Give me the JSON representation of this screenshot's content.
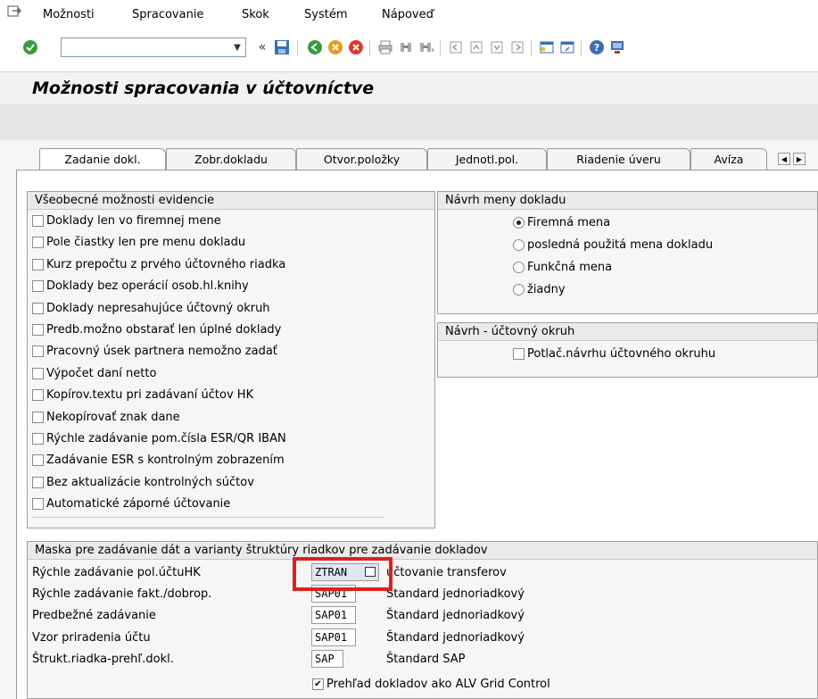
{
  "menu": {
    "items": [
      "Možnosti",
      "Spracovanie",
      "Skok",
      "Systém",
      "Nápoveď"
    ]
  },
  "toolbar": {
    "command_value": ""
  },
  "title": "Možnosti spracovania v účtovníctve",
  "tabs": [
    "Zadanie dokl.",
    "Zobr.dokladu",
    "Otvor.položky",
    "Jednotl.pol.",
    "Riadenie úveru",
    "Avíza"
  ],
  "general": {
    "header": "Všeobecné možnosti evidencie",
    "options": [
      {
        "label": "Doklady len vo firemnej mene",
        "checked": false
      },
      {
        "label": "Pole čiastky len pre menu dokladu",
        "checked": false
      },
      {
        "label": "Kurz prepočtu z prvého účtovného riadka",
        "checked": false
      },
      {
        "label": "Doklady bez operácií osob.hl.knihy",
        "checked": false
      },
      {
        "label": "Doklady nepresahujúce účtovný okruh",
        "checked": false
      },
      {
        "label": "Predb.možno obstarať len úplné doklady",
        "checked": false
      },
      {
        "label": "Pracovný úsek partnera nemožno zadať",
        "checked": false
      },
      {
        "label": "Výpočet daní netto",
        "checked": false
      },
      {
        "label": "Kopírov.textu pri zadávaní účtov HK",
        "checked": false
      },
      {
        "label": "Nekopírovať znak dane",
        "checked": false
      },
      {
        "label": "Rýchle zadávanie pom.čísla ESR/QR IBAN",
        "checked": false
      },
      {
        "label": "Zadávanie ESR s kontrolným zobrazením",
        "checked": false
      },
      {
        "label": "Bez aktualizácie kontrolných súčtov",
        "checked": false
      },
      {
        "label": "Automatické záporné účtovanie",
        "checked": false
      }
    ]
  },
  "currency": {
    "header": "Návrh meny dokladu",
    "options": [
      {
        "label": "Firemná mena",
        "selected": true
      },
      {
        "label": "posledná použitá mena dokladu",
        "selected": false
      },
      {
        "label": "Funkčná mena",
        "selected": false
      },
      {
        "label": "žiadny",
        "selected": false
      }
    ]
  },
  "company": {
    "header": "Návrh - účtovný okruh",
    "option": {
      "label": "Potlač.návrhu účtovného okruhu",
      "checked": false
    }
  },
  "mask": {
    "header": "Maska pre zadávanie dát a varianty štruktúry riadkov pre zadávanie dokladov",
    "rows": [
      {
        "label": "Rýchle zadávanie pol.účtuHK",
        "value": "ZTRAN",
        "desc": "účtovanie transferov"
      },
      {
        "label": "Rýchle zadávanie fakt./dobrop.",
        "value": "SAP01",
        "desc": "Štandard jednoriadkový"
      },
      {
        "label": "Predbežné zadávanie",
        "value": "SAP01",
        "desc": "Štandard jednoriadkový"
      },
      {
        "label": "Vzor priradenia účtu",
        "value": "SAP01",
        "desc": "Štandard jednoriadkový"
      },
      {
        "label": "Štrukt.riadka-prehľ.dokl.",
        "value": "SAP",
        "desc": "Štandard SAP"
      }
    ],
    "alv": {
      "label": "Prehľad dokladov ako ALV Grid Control",
      "checked": true
    }
  },
  "colors": {
    "highlight": "#e02020",
    "accent": "#2f8f2f"
  }
}
